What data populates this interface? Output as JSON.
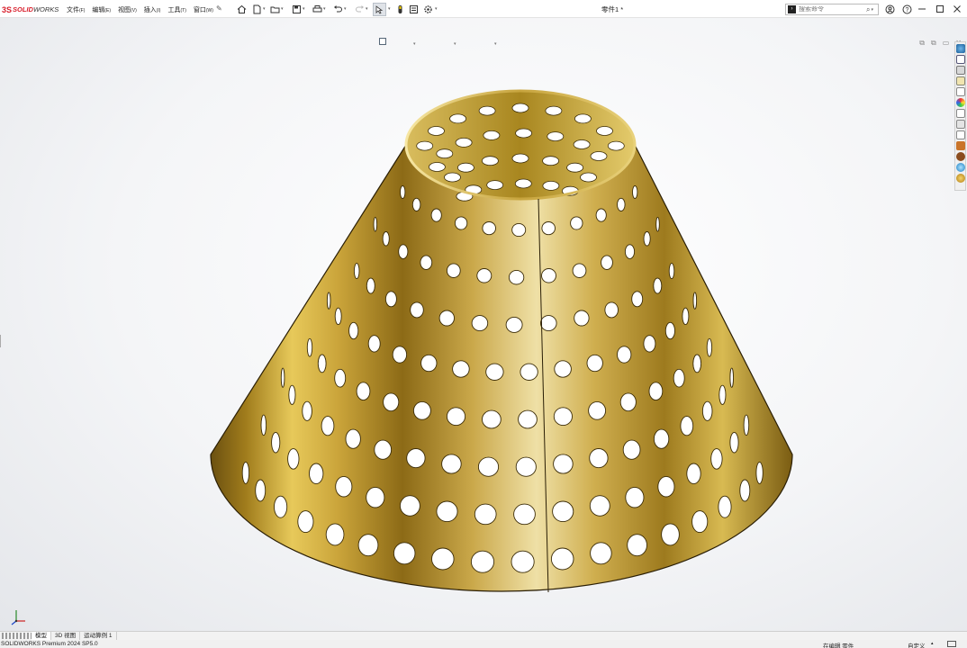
{
  "app": {
    "logo_mark": "3S",
    "logo_word_1": "SOLID",
    "logo_word_2": "WORKS",
    "document_title": "零件1 *"
  },
  "menus": [
    {
      "label": "文件",
      "hotkey": "(F)"
    },
    {
      "label": "编辑",
      "hotkey": "(E)"
    },
    {
      "label": "视图",
      "hotkey": "(V)"
    },
    {
      "label": "插入",
      "hotkey": "(I)"
    },
    {
      "label": "工具",
      "hotkey": "(T)"
    },
    {
      "label": "窗口",
      "hotkey": "(W)"
    }
  ],
  "search": {
    "placeholder": "搜索命令"
  },
  "tabs": [
    {
      "label": "模型"
    },
    {
      "label": "3D 视图"
    },
    {
      "label": "运动算例 1"
    }
  ],
  "status": {
    "version": "SOLIDWORKS Premium 2024 SP5.0",
    "mode": "在编辑 零件",
    "units": "自定义"
  },
  "colors": {
    "brand_red": "#d81e2b",
    "part_gold_light": "#f3df8a",
    "part_gold_mid": "#c9a334",
    "part_gold_dark": "#6b5010",
    "background_light": "#ffffff",
    "background_edge": "#e4e6ea"
  },
  "icons": {
    "toolbar": [
      "home-icon",
      "new-file-icon",
      "open-icon",
      "save-icon",
      "print-icon",
      "undo-icon",
      "redo-icon",
      "select-icon",
      "rebuild-icon",
      "file-properties-icon",
      "options-icon"
    ],
    "heads_up": [
      "view-orientation-icon",
      "section-view-icon",
      "zoom-to-fit-icon",
      "zoom-area-icon",
      "previous-view-icon",
      "display-style-icon",
      "hide-show-icon",
      "appearance-icon",
      "scene-icon",
      "view-settings-icon",
      "display-pane-icon"
    ],
    "task_pane": [
      "solidworks-resources-icon",
      "design-library-icon",
      "file-explorer-icon",
      "view-palette-icon",
      "appearances-icon",
      "custom-properties-icon"
    ]
  }
}
